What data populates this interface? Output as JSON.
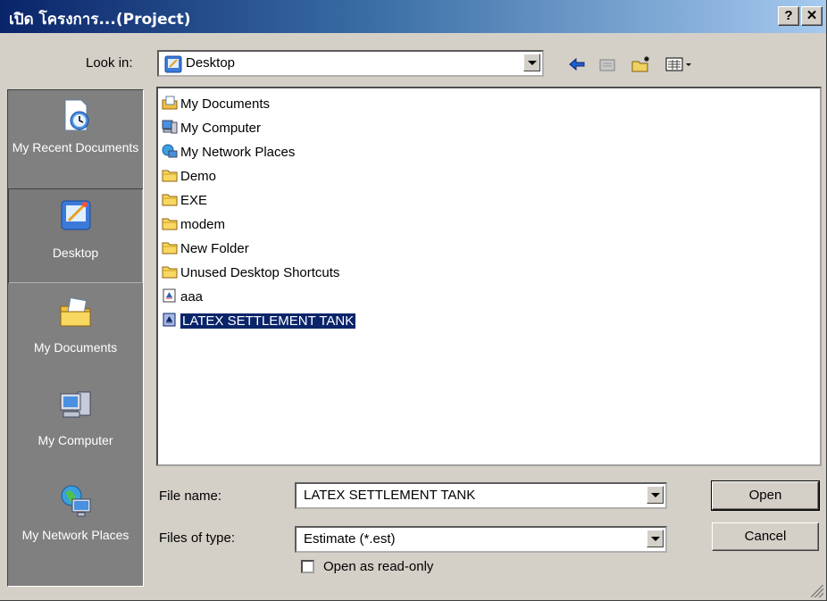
{
  "window": {
    "title": "เปิด โครงการ...(Project)",
    "help_label": "?",
    "close_label": "✕"
  },
  "lookin": {
    "label": "Look in:",
    "value": "Desktop"
  },
  "toolbar": {
    "back_icon": "back-arrow-icon",
    "up_icon": "up-folder-icon",
    "new_folder_icon": "new-folder-icon",
    "view_icon": "view-menu-icon"
  },
  "places": [
    {
      "label": "My Recent Documents",
      "icon": "recent-documents-icon"
    },
    {
      "label": "Desktop",
      "icon": "desktop-icon"
    },
    {
      "label": "My Documents",
      "icon": "my-documents-icon"
    },
    {
      "label": "My Computer",
      "icon": "my-computer-icon"
    },
    {
      "label": "My Network Places",
      "icon": "network-places-icon"
    }
  ],
  "files": [
    {
      "name": "My Documents",
      "icon": "my-documents-icon"
    },
    {
      "name": "My Computer",
      "icon": "my-computer-icon"
    },
    {
      "name": "My Network Places",
      "icon": "network-places-icon"
    },
    {
      "name": "Demo",
      "icon": "folder-icon"
    },
    {
      "name": "EXE",
      "icon": "folder-icon"
    },
    {
      "name": "modem",
      "icon": "folder-icon"
    },
    {
      "name": "New Folder",
      "icon": "folder-icon"
    },
    {
      "name": "Unused Desktop Shortcuts",
      "icon": "folder-icon"
    },
    {
      "name": "aaa",
      "icon": "estimate-file-icon"
    },
    {
      "name": "LATEX SETTLEMENT TANK",
      "icon": "estimate-file-icon",
      "selected": true
    }
  ],
  "filename": {
    "label": "File name:",
    "value": "LATEX SETTLEMENT TANK"
  },
  "filetype": {
    "label": "Files of type:",
    "value": "Estimate (*.est)"
  },
  "readonly": {
    "label": "Open as read-only",
    "checked": false
  },
  "buttons": {
    "open": "Open",
    "cancel": "Cancel"
  },
  "colors": {
    "title_start": "#0a246a",
    "title_end": "#a6caf0",
    "face": "#d4d0c8",
    "places_bg": "#808080",
    "selection": "#0a246a"
  }
}
